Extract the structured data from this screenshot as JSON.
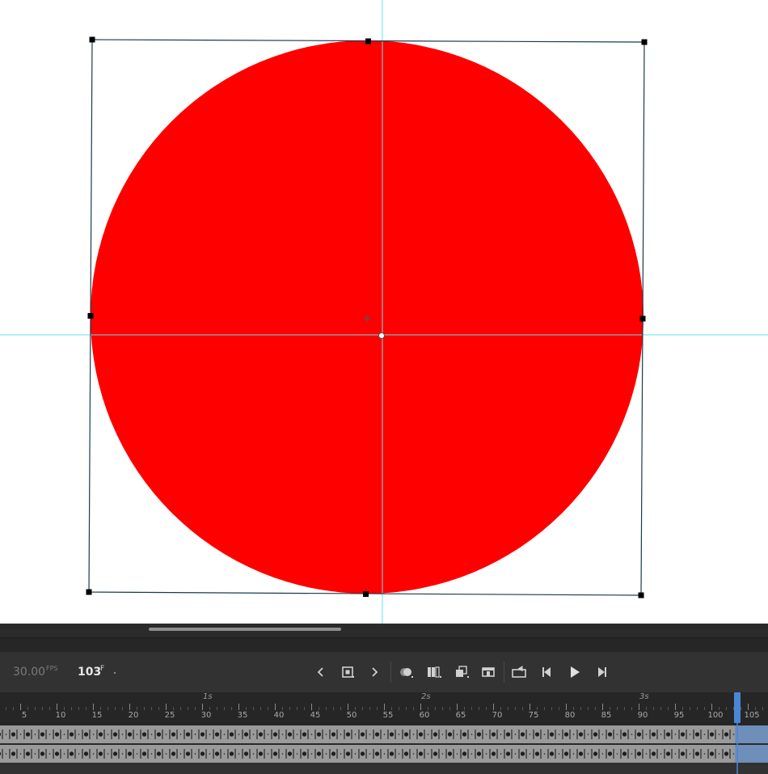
{
  "stage": {
    "fill_color": "#ff0000",
    "guide_color": "#61e3ef",
    "bbox_color": "#1a3a4a"
  },
  "timeline": {
    "fps_value": "30.00",
    "fps_unit": "FPS",
    "current_frame": "103",
    "frame_unit": "F",
    "playhead_color": "#4a86d6",
    "seconds_markers": [
      "1s",
      "2s",
      "3s"
    ],
    "tick_labels": [
      "5",
      "10",
      "15",
      "20",
      "25",
      "30",
      "35",
      "40",
      "45",
      "50",
      "55",
      "60",
      "65",
      "70",
      "75",
      "80",
      "85",
      "90",
      "95",
      "100",
      "105"
    ],
    "controls": [
      {
        "name": "prev-keyframe-icon"
      },
      {
        "name": "insert-keyframe-icon"
      },
      {
        "name": "next-keyframe-icon"
      },
      {
        "name": "onion-skin-icon"
      },
      {
        "name": "edit-multiple-frames-icon"
      },
      {
        "name": "tween-icon"
      },
      {
        "name": "camera-icon"
      },
      {
        "name": "loop-icon"
      },
      {
        "name": "step-back-icon"
      },
      {
        "name": "play-icon"
      },
      {
        "name": "step-forward-icon"
      }
    ]
  }
}
